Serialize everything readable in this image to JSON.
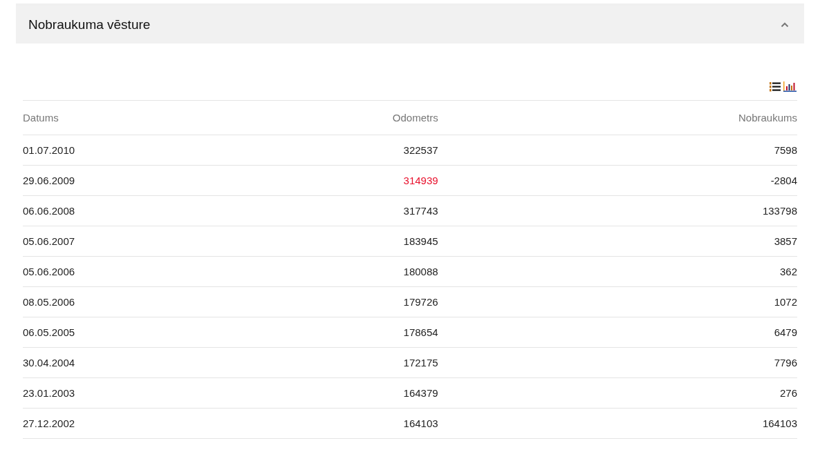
{
  "panel": {
    "title": "Nobraukuma vēsture",
    "expanded": true
  },
  "table": {
    "columns": [
      "Datums",
      "Odometrs",
      "Nobraukums"
    ],
    "rows": [
      {
        "date": "01.07.2010",
        "odometer": "322537",
        "mileage": "7598",
        "flagged": false
      },
      {
        "date": "29.06.2009",
        "odometer": "314939",
        "mileage": "-2804",
        "flagged": true
      },
      {
        "date": "06.06.2008",
        "odometer": "317743",
        "mileage": "133798",
        "flagged": false
      },
      {
        "date": "05.06.2007",
        "odometer": "183945",
        "mileage": "3857",
        "flagged": false
      },
      {
        "date": "05.06.2006",
        "odometer": "180088",
        "mileage": "362",
        "flagged": false
      },
      {
        "date": "08.05.2006",
        "odometer": "179726",
        "mileage": "1072",
        "flagged": false
      },
      {
        "date": "06.05.2005",
        "odometer": "178654",
        "mileage": "6479",
        "flagged": false
      },
      {
        "date": "30.04.2004",
        "odometer": "172175",
        "mileage": "7796",
        "flagged": false
      },
      {
        "date": "23.01.2003",
        "odometer": "164379",
        "mileage": "276",
        "flagged": false
      },
      {
        "date": "27.12.2002",
        "odometer": "164103",
        "mileage": "164103",
        "flagged": false
      }
    ]
  }
}
